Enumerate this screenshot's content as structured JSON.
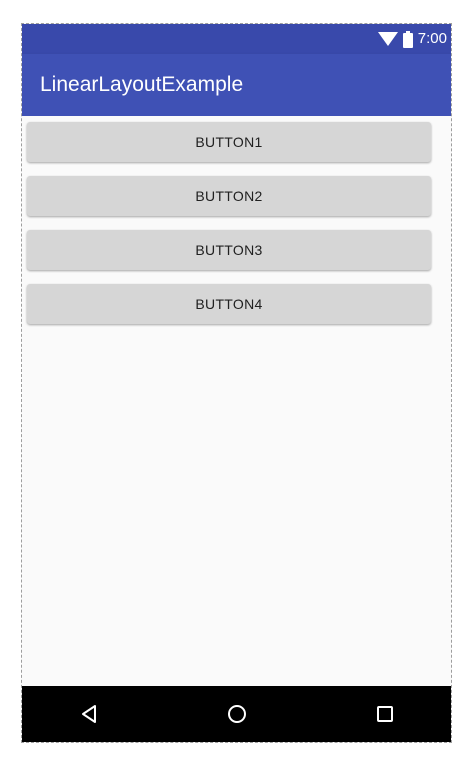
{
  "status_bar": {
    "time": "7:00",
    "icons": [
      "wifi-icon",
      "battery-icon"
    ]
  },
  "app_bar": {
    "title": "LinearLayoutExample"
  },
  "buttons": [
    {
      "label": "BUTTON1"
    },
    {
      "label": "BUTTON2"
    },
    {
      "label": "BUTTON3"
    },
    {
      "label": "BUTTON4"
    }
  ],
  "nav_bar": {
    "icons": [
      "back-icon",
      "home-icon",
      "recents-icon"
    ]
  },
  "colors": {
    "status_bar": "#3949ab",
    "primary": "#3f51b5",
    "background": "#fafafa",
    "button": "#d6d6d6",
    "nav_bar": "#000000"
  }
}
